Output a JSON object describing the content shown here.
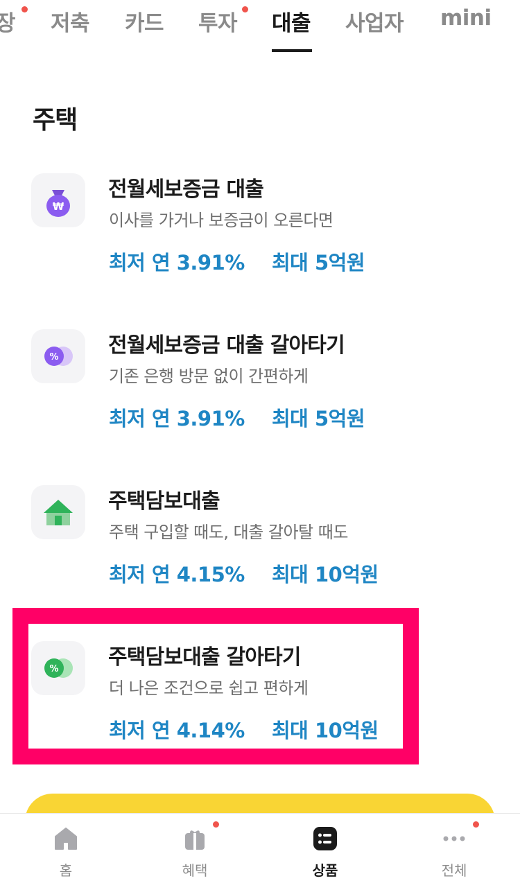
{
  "tabs": [
    {
      "label": "장",
      "dot": true
    },
    {
      "label": "저축",
      "dot": false
    },
    {
      "label": "카드",
      "dot": false
    },
    {
      "label": "투자",
      "dot": true
    },
    {
      "label": "대출",
      "dot": false,
      "active": true
    },
    {
      "label": "사업자",
      "dot": false
    },
    {
      "label": "mini",
      "dot": false
    }
  ],
  "section": {
    "title": "주택"
  },
  "products": [
    {
      "title": "전월세보증금 대출",
      "desc": "이사를 가거나 보증금이 오른다면",
      "rate": "최저 연 3.91%",
      "limit": "최대 5억원",
      "icon": "money-bag-icon"
    },
    {
      "title": "전월세보증금 대출 갈아타기",
      "desc": "기존 은행 방문 없이 간편하게",
      "rate": "최저 연 3.91%",
      "limit": "최대 5억원",
      "icon": "purple-percent-coins-icon"
    },
    {
      "title": "주택담보대출",
      "desc": "주택 구입할 때도, 대출 갈아탈 때도",
      "rate": "최저 연 4.15%",
      "limit": "최대 10억원",
      "icon": "green-house-icon"
    },
    {
      "title": "주택담보대출 갈아타기",
      "desc": "더 나은 조건으로 쉽고 편하게",
      "rate": "최저 연 4.14%",
      "limit": "최대 10억원",
      "icon": "green-percent-coins-icon"
    }
  ],
  "colors": {
    "accent": "#1f86c4",
    "highlight": "#ff0066",
    "banner": "#f9d534",
    "dot": "#f0544c"
  },
  "bottom_nav": [
    {
      "label": "홈",
      "icon": "home-icon",
      "dot": false
    },
    {
      "label": "혜택",
      "icon": "gift-icon",
      "dot": true
    },
    {
      "label": "상품",
      "icon": "products-icon",
      "dot": false,
      "active": true
    },
    {
      "label": "전체",
      "icon": "more-icon",
      "dot": true
    }
  ]
}
